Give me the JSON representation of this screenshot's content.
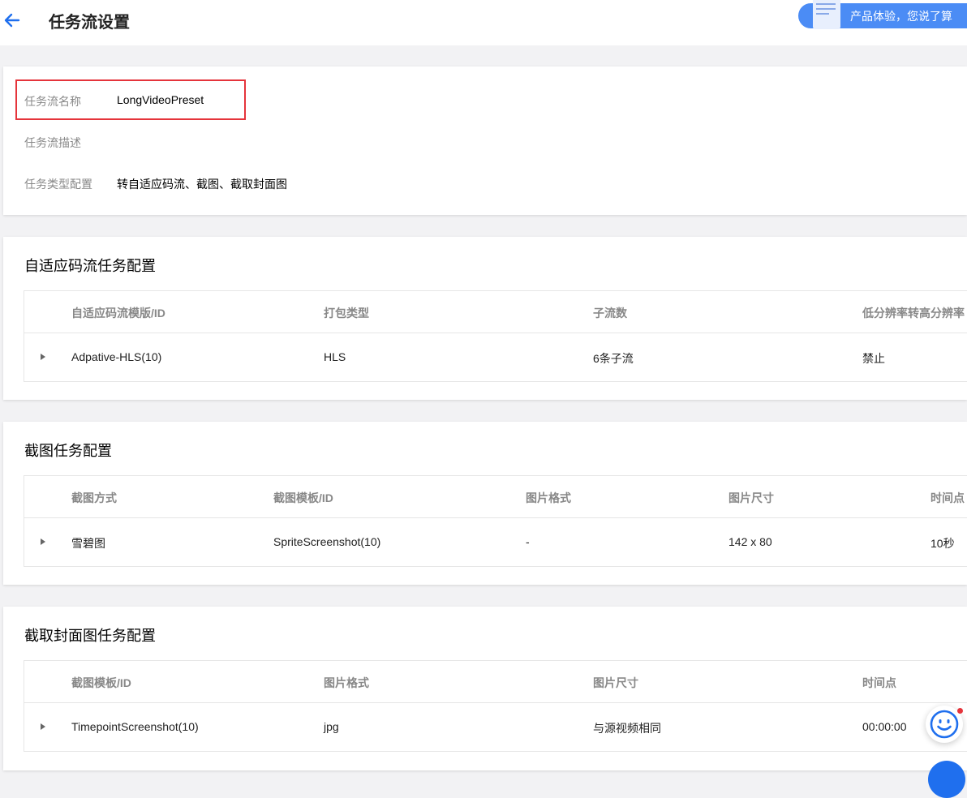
{
  "header": {
    "title": "任务流设置",
    "feedback_label": "产品体验，您说了算"
  },
  "info": {
    "name_label": "任务流名称",
    "name_value": "LongVideoPreset",
    "desc_label": "任务流描述",
    "desc_value": "",
    "type_label": "任务类型配置",
    "type_value": "转自适应码流、截图、截取封面图"
  },
  "adaptive": {
    "title": "自适应码流任务配置",
    "columns": [
      "自适应码流模版/ID",
      "打包类型",
      "子流数",
      "低分辨率转高分辨率"
    ],
    "rows": [
      [
        "Adpative-HLS(10)",
        "HLS",
        "6条子流",
        "禁止"
      ]
    ]
  },
  "snapshot": {
    "title": "截图任务配置",
    "columns": [
      "截图方式",
      "截图模板/ID",
      "图片格式",
      "图片尺寸",
      "时间点"
    ],
    "rows": [
      [
        "雪碧图",
        "SpriteScreenshot(10)",
        "-",
        "142 x 80",
        "10秒"
      ]
    ]
  },
  "cover": {
    "title": "截取封面图任务配置",
    "columns": [
      "截图模板/ID",
      "图片格式",
      "图片尺寸",
      "时间点"
    ],
    "rows": [
      [
        "TimepointScreenshot(10)",
        "jpg",
        "与源视频相同",
        "00:00:00"
      ]
    ]
  },
  "colors": {
    "accent": "#1f6fee",
    "highlight": "#e5343b"
  }
}
